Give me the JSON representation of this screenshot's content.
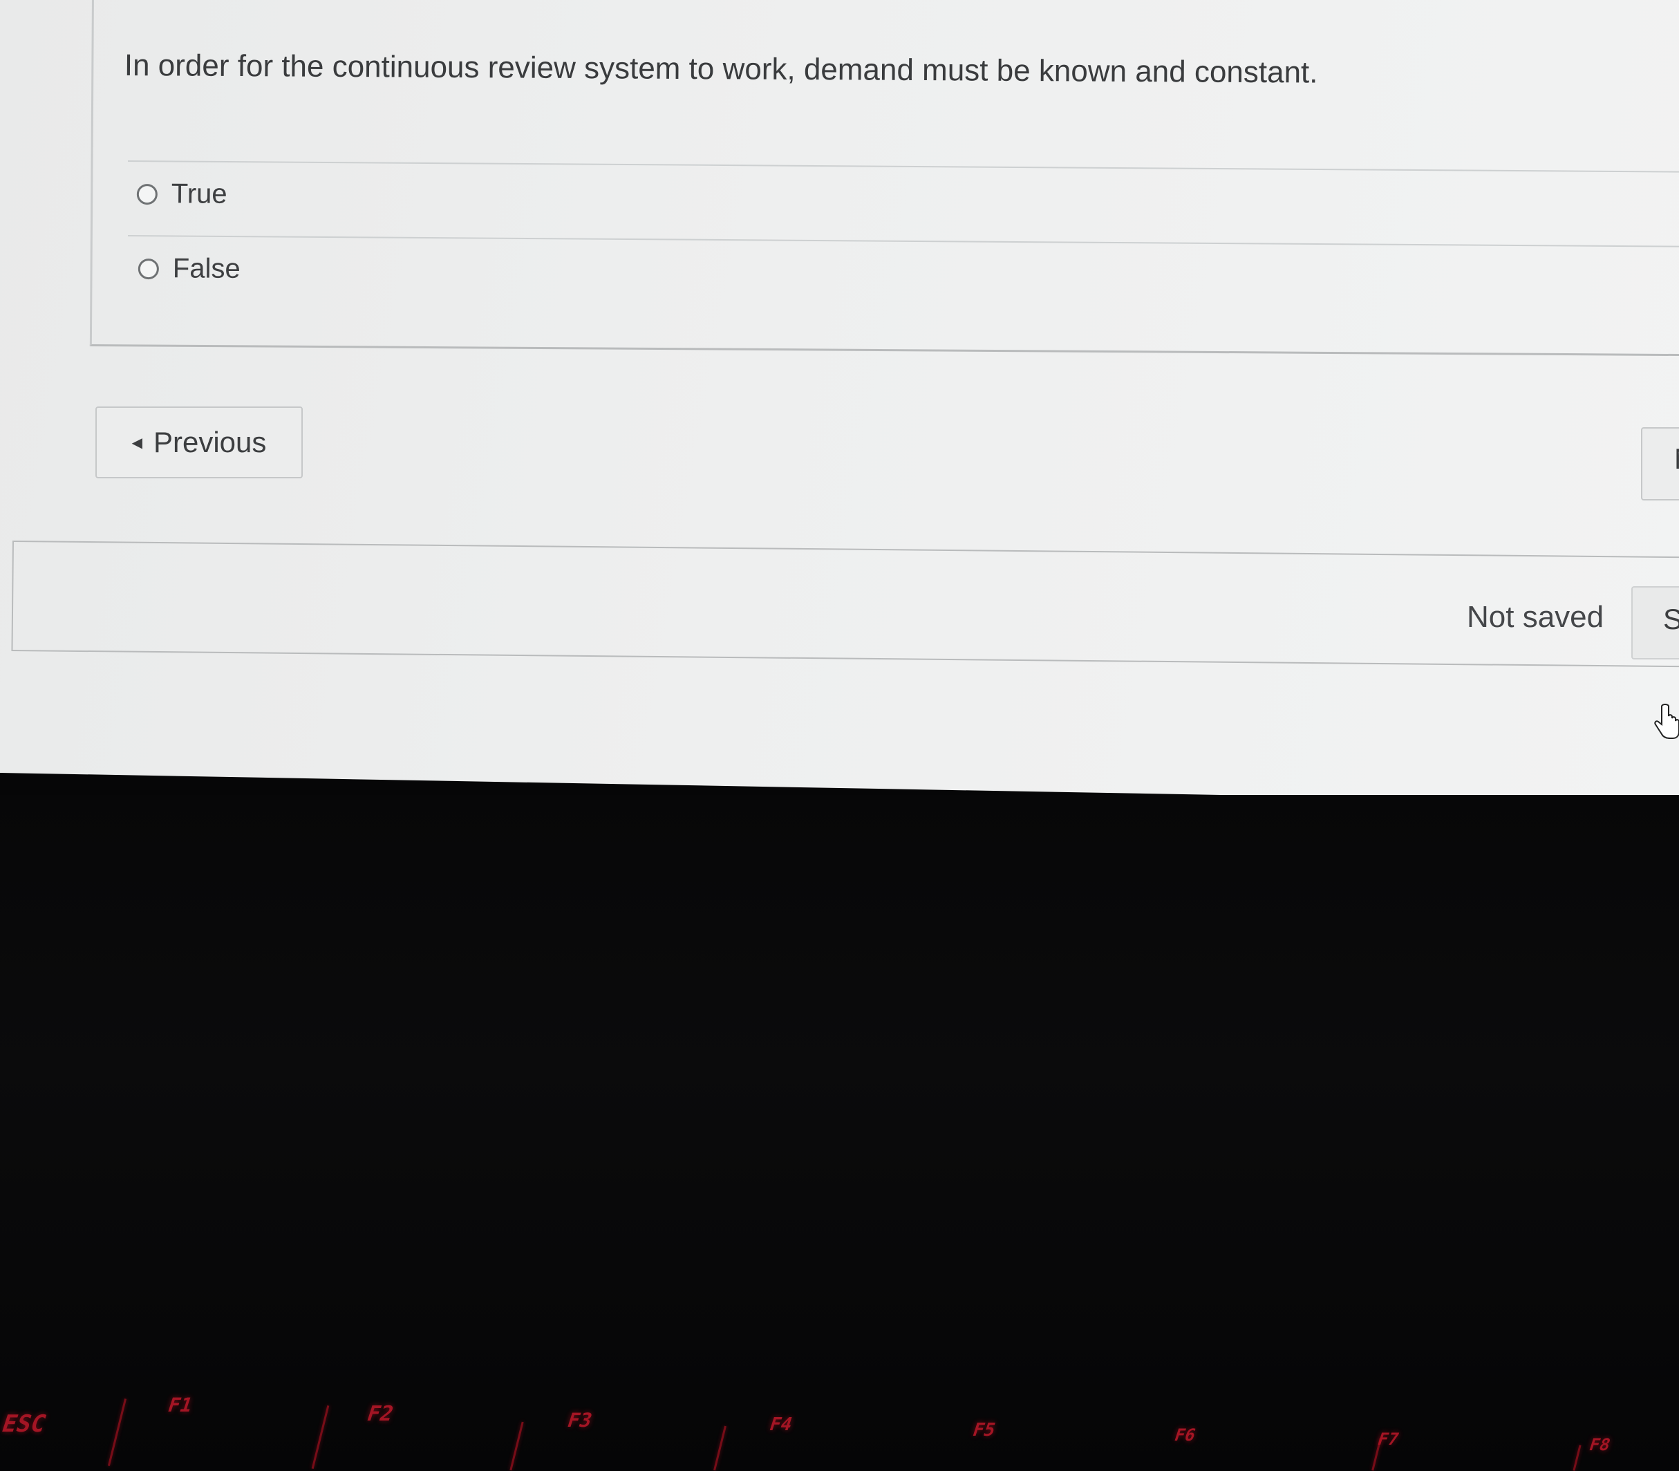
{
  "question": {
    "text": "In order for the continuous review system to work, demand must be known and constant.",
    "options": [
      {
        "label": "True",
        "selected": false
      },
      {
        "label": "False",
        "selected": false
      }
    ]
  },
  "navigation": {
    "previous_label": "Previous",
    "next_label_partial": "N"
  },
  "save_bar": {
    "status": "Not saved",
    "save_label_partial": "S"
  },
  "keyboard": {
    "keys": [
      "ESC",
      "F1",
      "F2",
      "F3",
      "F4",
      "F5",
      "F6",
      "F7",
      "F8"
    ],
    "backlight_color": "#c0182a"
  },
  "colors": {
    "screen_bg": "#eeefef",
    "text": "#3a3c3e",
    "border": "#c6c8c9"
  }
}
